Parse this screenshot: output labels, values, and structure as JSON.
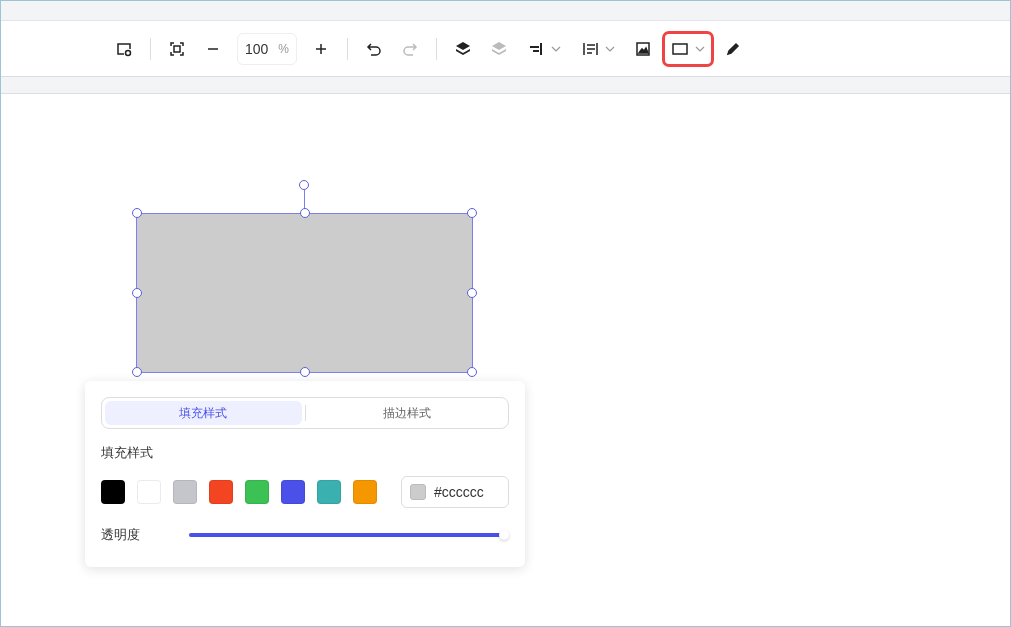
{
  "toolbar": {
    "buttons": [
      {
        "kind": "button",
        "disabled": false,
        "selected": false
      },
      {
        "kind": "button",
        "disabled": false,
        "selected": false
      },
      {
        "kind": "button",
        "disabled": false,
        "selected": false
      },
      {
        "kind": "button",
        "disabled": false,
        "selected": false
      },
      {
        "kind": "button",
        "disabled": false,
        "selected": false
      },
      {
        "kind": "button",
        "disabled": true,
        "selected": false
      },
      {
        "kind": "button",
        "disabled": false,
        "selected": false
      },
      {
        "kind": "button",
        "disabled": true,
        "selected": false
      },
      {
        "kind": "dropdown",
        "disabled": false,
        "selected": false
      },
      {
        "kind": "dropdown",
        "disabled": false,
        "selected": false
      },
      {
        "kind": "button",
        "disabled": false,
        "selected": false
      },
      {
        "kind": "dropdown",
        "disabled": false,
        "selected": true
      },
      {
        "kind": "button",
        "disabled": false,
        "selected": false
      }
    ],
    "zoom": {
      "value": "100",
      "unit": "%"
    }
  },
  "shape": {
    "color": "#cccccc"
  },
  "popover": {
    "tabs": [
      {
        "label": "填充样式",
        "selected": true
      },
      {
        "label": "描边样式",
        "selected": false
      }
    ],
    "section_title": "填充样式",
    "swatches": [
      {
        "color": "#000000"
      },
      {
        "color": "#ffffff"
      },
      {
        "color": "#c5c6cb"
      },
      {
        "color": "#f44522"
      },
      {
        "color": "#3cc155"
      },
      {
        "color": "#4b51e8"
      },
      {
        "color": "#3ab0b0"
      },
      {
        "color": "#f59700"
      }
    ],
    "hex_field": {
      "color": "#cccccc",
      "value": "#cccccc"
    },
    "opacity": {
      "label": "透明度",
      "level": 1
    }
  }
}
